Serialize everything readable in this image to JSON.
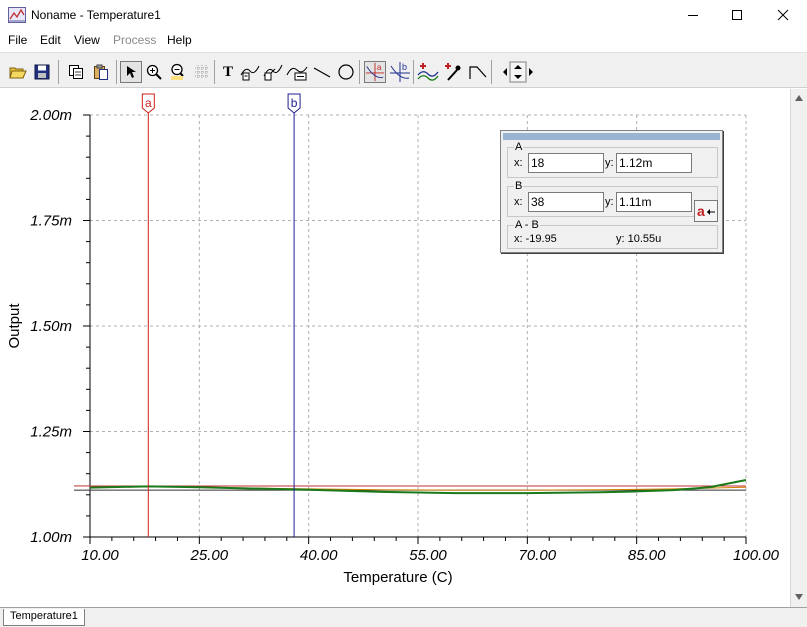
{
  "window": {
    "title": "Noname - Temperature1"
  },
  "menu": [
    {
      "label": "File",
      "enabled": true
    },
    {
      "label": "Edit",
      "enabled": true
    },
    {
      "label": "View",
      "enabled": true
    },
    {
      "label": "Process",
      "enabled": false
    },
    {
      "label": "Help",
      "enabled": true
    }
  ],
  "toolbar": {
    "icons": [
      "open-folder-icon",
      "save-icon",
      "copy-icon",
      "paste-icon",
      "pointer-icon",
      "zoom-in-icon",
      "zoom-100-icon",
      "grid-icon",
      "text-icon",
      "curve-label-icon",
      "curve-label-2-icon",
      "curve-marker-icon",
      "line-icon",
      "circle-icon",
      "cursor-a-icon",
      "cursor-b-icon",
      "add-curve-icon",
      "add-point-icon",
      "slope-icon",
      "nav-arrows-icon"
    ],
    "text_icon_glyph": "T",
    "cursor_a_glyph": "a",
    "cursor_b_glyph": "b"
  },
  "colors": {
    "cursor_a": "#cc2020",
    "cursor_b": "#202090",
    "curve_main": "#1a7a1a",
    "curve_red": "#c03030",
    "curve_orange": "#d08000",
    "curve_black": "#303030",
    "grid": "#b0b0b0",
    "panel_title": "#99b4d1"
  },
  "chart_data": {
    "type": "line",
    "xlabel": "Temperature (C)",
    "ylabel": "Output",
    "xlim": [
      10,
      100
    ],
    "ylim": [
      1.0,
      2.0
    ],
    "x_ticks": [
      "10.00",
      "25.00",
      "40.00",
      "55.00",
      "70.00",
      "85.00",
      "100.00"
    ],
    "y_ticks": [
      "1.00m",
      "1.25m",
      "1.50m",
      "1.75m",
      "2.00m"
    ],
    "grid": true,
    "series": [
      {
        "color_key": "curve_main",
        "x": [
          10,
          18,
          25,
          32,
          40,
          50,
          60,
          70,
          80,
          85,
          90,
          95,
          100
        ],
        "y": [
          1.117,
          1.12,
          1.118,
          1.115,
          1.112,
          1.107,
          1.104,
          1.104,
          1.106,
          1.108,
          1.111,
          1.118,
          1.135
        ]
      },
      {
        "color_key": "curve_orange",
        "x": [
          10,
          18,
          25,
          32,
          40,
          50,
          60,
          70,
          80,
          90,
          100
        ],
        "y": [
          1.118,
          1.12,
          1.118,
          1.116,
          1.114,
          1.112,
          1.111,
          1.111,
          1.112,
          1.114,
          1.118
        ]
      },
      {
        "color_key": "curve_red",
        "x": [
          10,
          100
        ],
        "y": [
          1.121,
          1.121
        ]
      },
      {
        "color_key": "curve_black",
        "x": [
          10,
          100
        ],
        "y": [
          1.111,
          1.111
        ]
      }
    ],
    "cursors": [
      {
        "label": "a",
        "x": 18,
        "color_key": "cursor_a"
      },
      {
        "label": "b",
        "x": 38,
        "color_key": "cursor_b"
      }
    ]
  },
  "cursor_panel": {
    "a_label": "A",
    "a_x": "18",
    "a_y": "1.12m",
    "b_label": "B",
    "b_x": "38",
    "b_y": "1.11m",
    "diff_label": "A - B",
    "diff_x": "-19.95",
    "diff_y": "10.55u",
    "x_label": "x:",
    "y_label": "y:",
    "diff_x_text": "x:  -19.95",
    "diff_y_text": "y: 10.55u",
    "arrow_glyph": "a"
  },
  "tabs": [
    {
      "label": "Temperature1",
      "active": true
    }
  ]
}
